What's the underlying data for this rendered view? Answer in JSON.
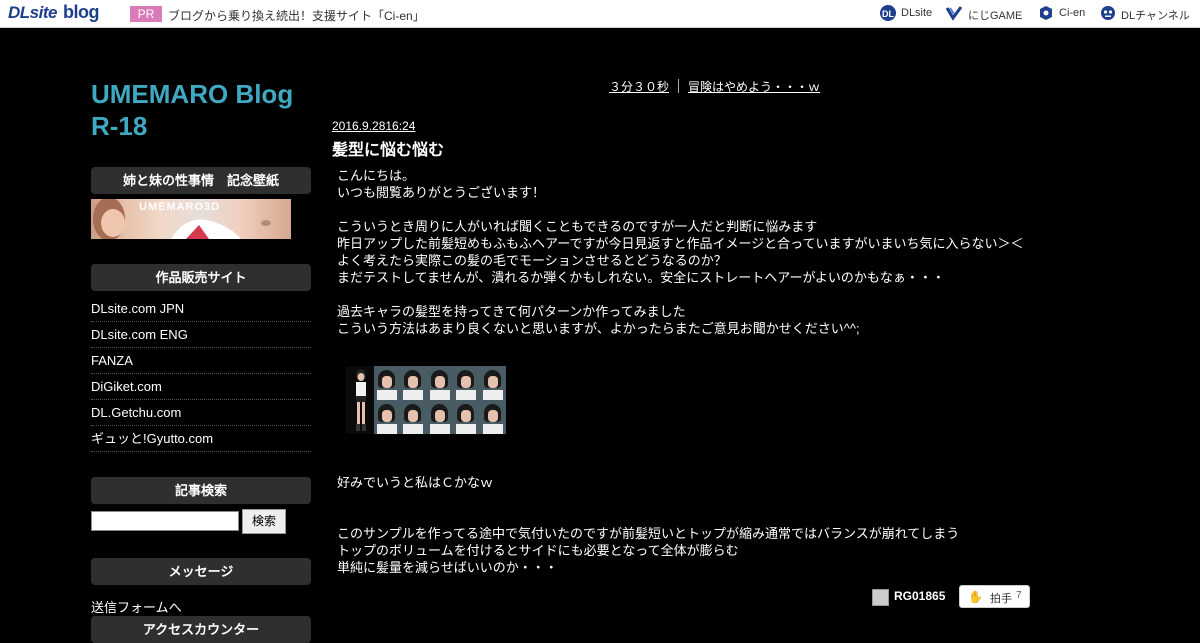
{
  "topbar": {
    "logo_dl": "DLsite",
    "logo_blog": "blog",
    "pr_badge": "PR",
    "pr_text": "ブログから乗り換え続出！支援サイト「Ci-en」",
    "links": [
      {
        "label": "DLsite",
        "icon": "dl-logo-icon"
      },
      {
        "label": "にじGAME",
        "icon": "nijigame-icon"
      },
      {
        "label": "Ci-en",
        "icon": "cien-icon"
      },
      {
        "label": "DLチャンネル",
        "icon": "robot-icon"
      }
    ]
  },
  "sidebar": {
    "blog_title": "UMEMARO Blog R-18",
    "wallpaper_heading": "姉と妹の性事情　記念壁紙",
    "banner_text": "UMEMARO3D",
    "sales_heading": "作品販売サイト",
    "sales_links": [
      "DLsite.com JPN",
      "DLsite.com ENG",
      "FANZA",
      "DiGiket.com",
      "DL.Getchu.com",
      "ギュッと!Gyutto.com"
    ],
    "search_heading": "記事検索",
    "search_button": "検索",
    "search_value": "",
    "message_heading": "メッセージ",
    "message_link": "送信フォームへ",
    "counter_heading": "アクセスカウンター"
  },
  "pager": {
    "prev_label": "３分３０秒",
    "next_label": "冒険はやめよう・・・ｗ"
  },
  "post": {
    "date": "2016.9.2816:24",
    "title": "髪型に悩む悩む",
    "paragraphs_1": [
      "こんにちは。",
      "いつも閲覧ありがとうございます！",
      "",
      "こういうとき周りに人がいれば聞くこともできるのですが一人だと判断に悩みます",
      "昨日アップした前髪短めもふもふヘアーですが今日見返すと作品イメージと合っていますがいまいち気に入らない＞＜",
      "よく考えたら実際この髪の毛でモーションさせるとどうなるのか？",
      "まだテストしてませんが、潰れるか弾くかもしれない。安全にストレートヘアーがよいのかもなぁ・・・",
      "",
      "過去キャラの髪型を持ってきて何パターンか作ってみました",
      "こういう方法はあまり良くないと思いますが、よかったらまたご意見お聞かせください^^;"
    ],
    "paragraph_choice": "好みでいうと私はＣかなｗ",
    "paragraphs_2": [
      "このサンプルを作ってる途中で気付いたのですが前髪短いとトップが縮み通常ではバランスが崩れてしまう",
      "トップのボリュームを付けるとサイドにも必要となって全体が膨らむ",
      "単純に髪量を減らせばいいのか・・・"
    ],
    "author": "RG01865",
    "clap_label": "拍手",
    "clap_count": "7"
  }
}
